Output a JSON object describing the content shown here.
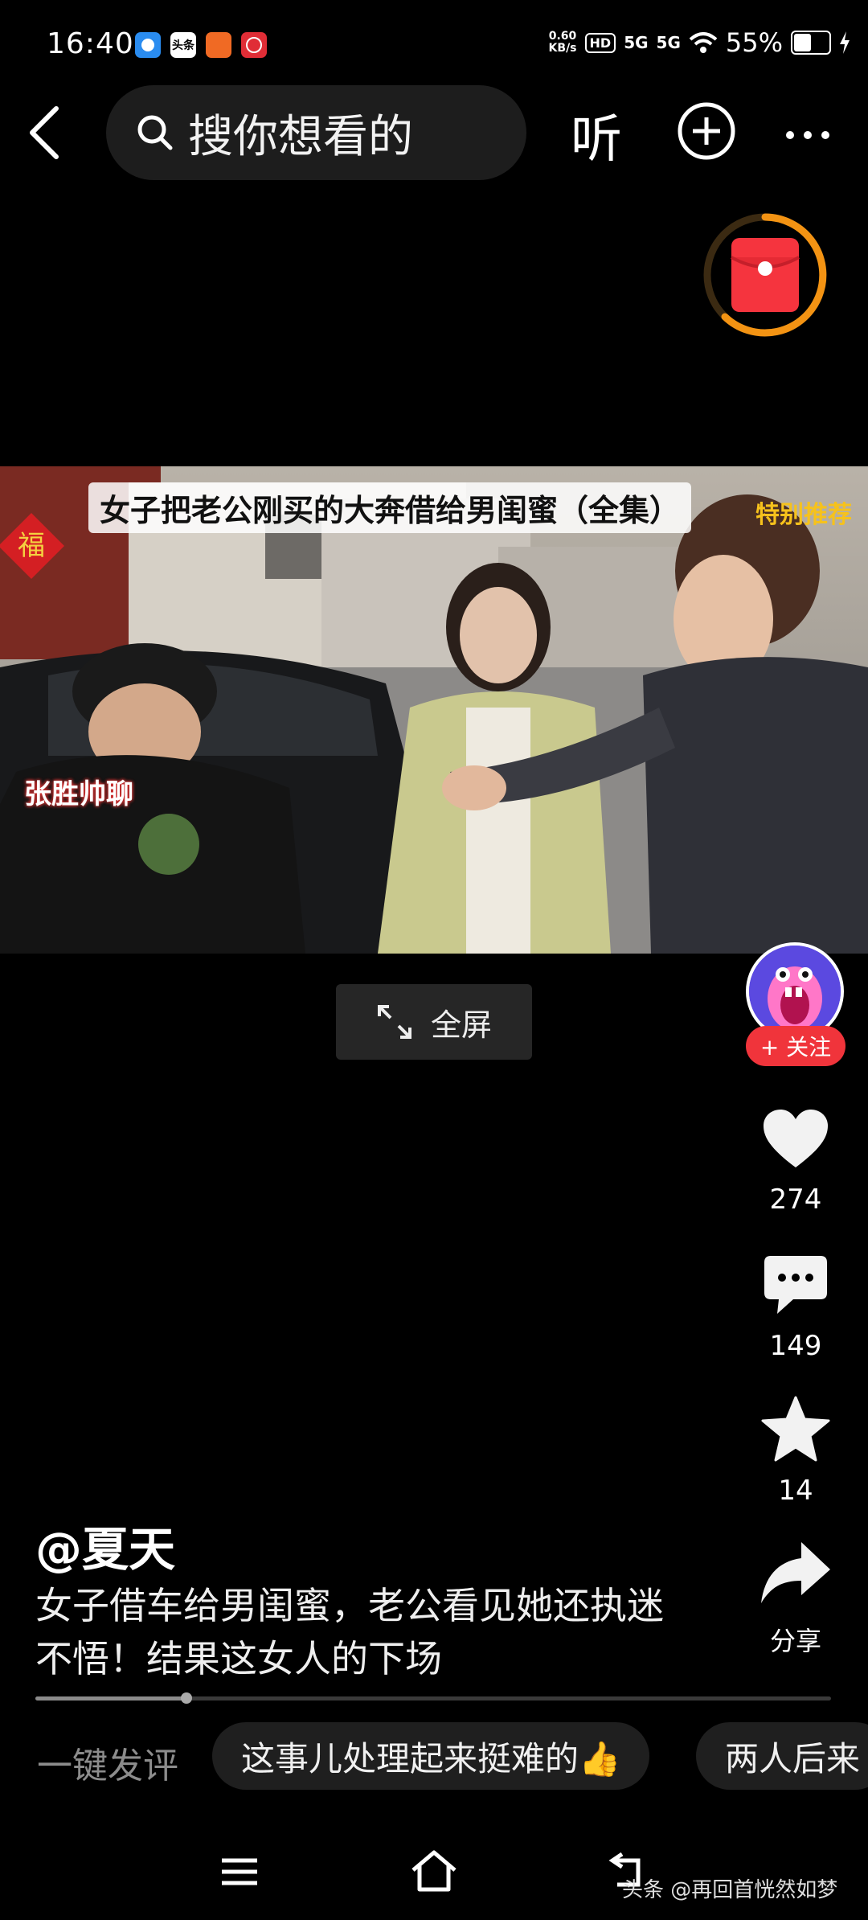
{
  "status_bar": {
    "time": "16:40",
    "apps": [
      "头条"
    ],
    "net_speed_value": "0.60",
    "net_speed_unit": "KB/s",
    "hd_label": "HD",
    "signal_1": "5G",
    "signal_2": "5G",
    "battery": "55%",
    "battery_level": 0.55
  },
  "top_nav": {
    "search_placeholder": "搜你想看的",
    "listen_label": "听"
  },
  "video": {
    "title": "女子把老公刚买的大奔借给男闺蜜（全集）",
    "tag": "特别推荐",
    "overlay_text": "张胜帅聊",
    "fullscreen_label": "全屏"
  },
  "side_actions": {
    "follow_label": "+ 关注",
    "likes": "274",
    "comments": "149",
    "favorites": "14",
    "share_label": "分享"
  },
  "post": {
    "author": "@夏天",
    "caption": "女子借车给男闺蜜，老公看见她还执迷不悟！结果这女人的下场",
    "progress": 0.19
  },
  "quick_comments": {
    "label": "一键发评",
    "chips": [
      "这事儿处理起来挺难的👍",
      "两人后来"
    ]
  },
  "footer": {
    "watermark": "头条 @再回首恍然如梦"
  }
}
